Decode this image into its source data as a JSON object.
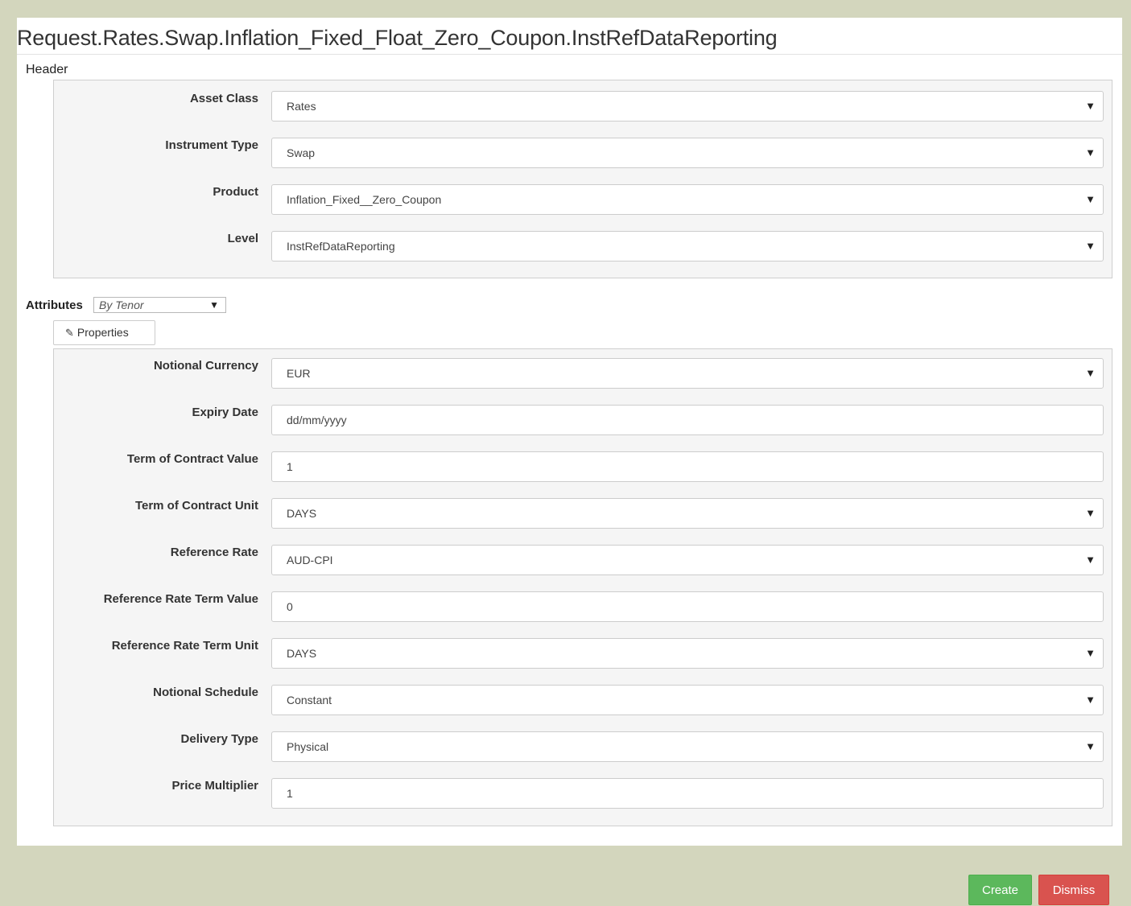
{
  "title": "Request.Rates.Swap.Inflation_Fixed_Float_Zero_Coupon.InstRefDataReporting",
  "header_section": {
    "label": "Header",
    "fields": [
      {
        "label": "Asset Class",
        "value": "Rates",
        "type": "select"
      },
      {
        "label": "Instrument Type",
        "value": "Swap",
        "type": "select"
      },
      {
        "label": "Product",
        "value": "Inflation_Fixed__Zero_Coupon",
        "type": "select"
      },
      {
        "label": "Level",
        "value": "InstRefDataReporting",
        "type": "select"
      }
    ]
  },
  "attributes_section": {
    "label": "Attributes",
    "mode_select": "By Tenor",
    "properties_button": "Properties",
    "fields": [
      {
        "label": "Notional Currency",
        "value": "EUR",
        "type": "select"
      },
      {
        "label": "Expiry Date",
        "value": "dd/mm/yyyy",
        "type": "input"
      },
      {
        "label": "Term of Contract Value",
        "value": "1",
        "type": "input"
      },
      {
        "label": "Term of Contract Unit",
        "value": "DAYS",
        "type": "select"
      },
      {
        "label": "Reference Rate",
        "value": "AUD-CPI",
        "type": "select"
      },
      {
        "label": "Reference Rate Term Value",
        "value": "0",
        "type": "input"
      },
      {
        "label": "Reference Rate Term Unit",
        "value": "DAYS",
        "type": "select"
      },
      {
        "label": "Notional Schedule",
        "value": "Constant",
        "type": "select"
      },
      {
        "label": "Delivery Type",
        "value": "Physical",
        "type": "select"
      },
      {
        "label": "Price Multiplier",
        "value": "1",
        "type": "input"
      }
    ]
  },
  "icons": {
    "dropdown": "triangle-down-icon",
    "edit": "pencil-icon"
  },
  "buttons": {
    "create": "Create",
    "dismiss": "Dismiss"
  },
  "colors": {
    "create": "#5cb85c",
    "dismiss": "#d9534f",
    "background": "#d3d6bd"
  }
}
